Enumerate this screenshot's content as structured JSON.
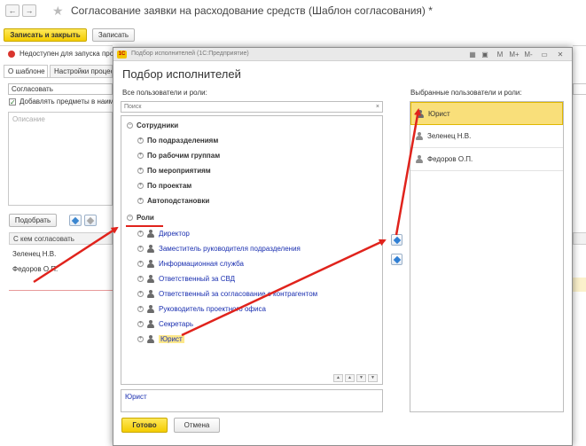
{
  "window": {
    "title": "Согласование заявки на расходование средств (Шаблон согласования) *",
    "back": "←",
    "forward": "→",
    "star": "★"
  },
  "toolbar": {
    "save_close_label": "Записать и закрыть",
    "save_label": "Записать"
  },
  "warning": {
    "text": "Недоступен для запуска проц"
  },
  "tabs": [
    {
      "label": "О шаблоне"
    },
    {
      "label": "Настройки процесс"
    }
  ],
  "form": {
    "type_value": "Согласовать",
    "add_items_label": "Добавлять предметы в наиме",
    "add_items_checked": true,
    "description_placeholder": "Описание",
    "pick_button_label": "Подобрать"
  },
  "bg_table": {
    "header": "С кем согласовать",
    "rows": [
      "Зеленец Н.В.",
      "Федоров О.П."
    ]
  },
  "dialog": {
    "caption": "Подбор исполнителей  (1С:Предприятие)",
    "title": "Подбор исполнителей",
    "toolbar_icons": [
      "▦",
      "▣",
      "M",
      "M+",
      "M-",
      "▭",
      "✕"
    ],
    "left_label": "Все пользователи и роли:",
    "search_placeholder": "Поиск",
    "search_clear": "×",
    "tree": {
      "employees_group": "Сотрудники",
      "employee_subgroups": [
        "По подразделениям",
        "По рабочим группам",
        "По мероприятиям",
        "По проектам",
        "Автоподстановки"
      ],
      "roles_group": "Роли",
      "roles": [
        "Директор",
        "Заместитель руководителя подразделения",
        "Информационная служба",
        "Ответственный за СВД",
        "Ответственный за согласование с контрагентом",
        "Руководитель проектного офиса",
        "Секретарь",
        "Юрист"
      ],
      "selected_role": "Юрист"
    },
    "bottom_tool_icons": [
      "▲",
      "▲",
      "▼",
      "▼"
    ],
    "description_value": "Юрист",
    "right_label": "Выбранные пользователи и роли:",
    "selected_items": [
      "Юрист",
      "Зеленец Н.В.",
      "Федоров О.П."
    ],
    "ok_label": "Готово",
    "cancel_label": "Отмена"
  },
  "colors": {
    "accent_yellow": "#f4cc00",
    "selection": "#f9df7a",
    "role_link": "#1a2fb0",
    "annotation_red": "#e0231c"
  }
}
